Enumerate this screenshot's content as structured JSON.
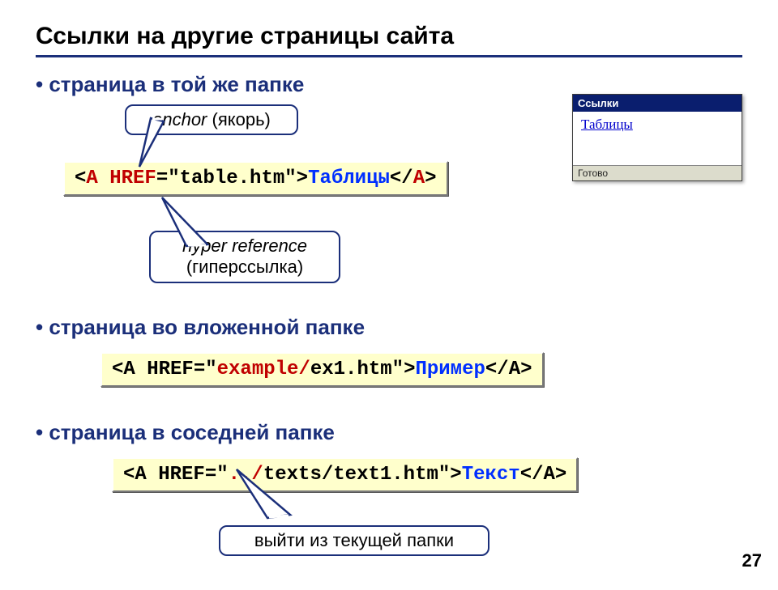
{
  "title": "Ссылки на другие страницы сайта",
  "page_number": "27",
  "sections": {
    "same_folder": {
      "heading": "страница в той же папке",
      "code": {
        "p1": "<",
        "a1": "A",
        "p2": " ",
        "href": "HREF",
        "p3": "=\"table.htm\">",
        "linktext": "Таблицы",
        "p4": "</",
        "a2": "A",
        "p5": ">"
      },
      "callout_anchor": {
        "line1": "anchor",
        "line2": " (якорь)"
      },
      "callout_href": {
        "line1": "hyper reference",
        "line2": "(гиперссылка)"
      }
    },
    "nested_folder": {
      "heading": "страница во вложенной папке",
      "code": {
        "p1": "<A HREF=\"",
        "dir": "example/",
        "p2": "ex1.htm\">",
        "linktext": "Пример",
        "p3": "</A>"
      }
    },
    "sibling_folder": {
      "heading": "страница в соседней папке",
      "code": {
        "p1": "<A HREF=\"",
        "up": "../",
        "p2": "texts/text1.htm\">",
        "linktext": "Текст",
        "p3": "</A>"
      },
      "callout_up": "выйти из текущей папки"
    }
  },
  "mini_window": {
    "title": "Ссылки",
    "link_text": "Таблицы",
    "status": "Готово"
  }
}
